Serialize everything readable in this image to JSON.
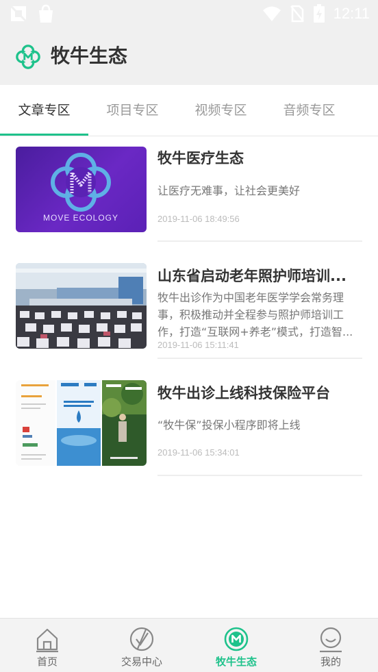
{
  "status_bar": {
    "time": "12:11",
    "icons": [
      "notification-off-icon",
      "bag-icon",
      "wifi-icon",
      "no-sim-icon",
      "battery-charging-icon"
    ]
  },
  "app_bar": {
    "logo_icon": "muniu-logo-icon",
    "title": "牧牛生态"
  },
  "tabs": [
    {
      "label": "文章专区",
      "active": true
    },
    {
      "label": "项目专区",
      "active": false
    },
    {
      "label": "视频专区",
      "active": false
    },
    {
      "label": "音频专区",
      "active": false
    }
  ],
  "articles": [
    {
      "title": "牧牛医疗生态",
      "description": "让医疗无难事，让社会更美好",
      "date": "2019-11-06 18:49:56",
      "thumbnail": {
        "caption": "MOVE ECOLOGY",
        "icon": "move-ecology-logo"
      }
    },
    {
      "title": "山东省启动老年照护师培训...",
      "description": "牧牛出诊作为中国老年医学学会常务理事，积极推动并全程参与照护师培训工作，打造“互联网+养老”模式，打造智...",
      "date": "2019-11-06 15:11:41",
      "thumbnail": {
        "icon": "conference-photo"
      }
    },
    {
      "title": "牧牛出诊上线科技保险平台",
      "description": "“牧牛保”投保小程序即将上线",
      "date": "2019-11-06 15:34:01",
      "thumbnail": {
        "icon": "insurance-brochure"
      }
    }
  ],
  "bottom_nav": [
    {
      "label": "首页",
      "icon": "home-icon",
      "active": false
    },
    {
      "label": "交易中心",
      "icon": "trade-icon",
      "active": false
    },
    {
      "label": "牧牛生态",
      "icon": "muniu-logo-icon",
      "active": true
    },
    {
      "label": "我的",
      "icon": "smile-profile-icon",
      "active": false
    }
  ],
  "colors": {
    "accent": "#1ec28b",
    "header_bg": "#f0f0f0",
    "text_primary": "#333333",
    "text_muted": "#999999"
  }
}
